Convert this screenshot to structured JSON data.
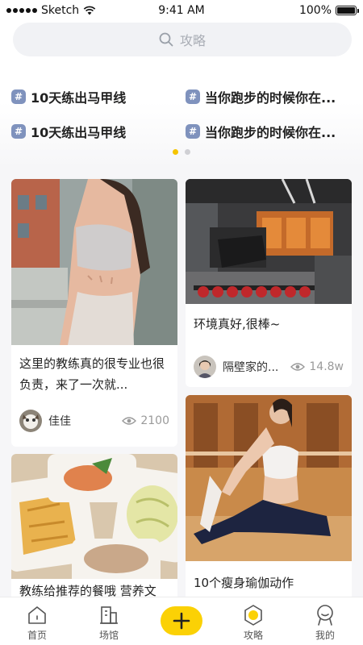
{
  "status_bar": {
    "carrier": "Sketch",
    "time": "9:41 AM",
    "battery": "100%"
  },
  "search": {
    "placeholder": "攻略"
  },
  "topics": [
    [
      "10天练出马甲线",
      "当你跑步的时候你在..."
    ],
    [
      "10天练出马甲线",
      "当你跑步的时候你在..."
    ]
  ],
  "carousel": {
    "pages": 2,
    "active": 0
  },
  "feed": {
    "left": [
      {
        "title": "这里的教练真的很专业也很负责，来了一次就...",
        "author": "佳佳",
        "views": "2100"
      },
      {
        "title": "教练给推荐的餐哦 营养文"
      }
    ],
    "right": [
      {
        "title": "环境真好,很棒~",
        "author": "隔壁家的...",
        "views": "14.8w"
      },
      {
        "title": "10个瘦身瑜伽动作"
      }
    ]
  },
  "tabbar": {
    "items": [
      {
        "label": "首页",
        "icon": "home-icon"
      },
      {
        "label": "场馆",
        "icon": "building-icon"
      },
      {
        "label": "",
        "icon": "plus-icon"
      },
      {
        "label": "攻略",
        "icon": "guide-icon",
        "active": true
      },
      {
        "label": "我的",
        "icon": "profile-icon"
      }
    ]
  },
  "colors": {
    "accent": "#fbd105",
    "hash_badge": "#7f92bd",
    "background": "#f6f6f8"
  }
}
